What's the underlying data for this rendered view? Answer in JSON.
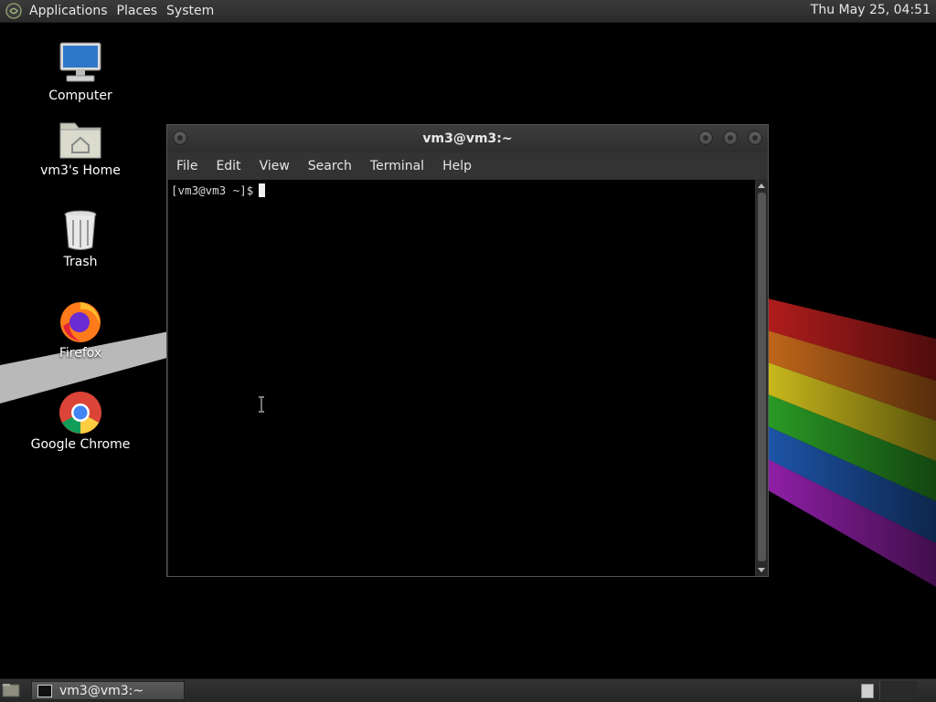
{
  "top_panel": {
    "menus": [
      "Applications",
      "Places",
      "System"
    ],
    "clock": "Thu May 25, 04:51"
  },
  "desktop": {
    "icons": [
      {
        "label": "Computer",
        "icon": "computer-icon"
      },
      {
        "label": "vm3's Home",
        "icon": "home-folder-icon"
      },
      {
        "label": "Trash",
        "icon": "trash-icon"
      },
      {
        "label": "Firefox",
        "icon": "firefox-icon"
      },
      {
        "label": "Google Chrome",
        "icon": "chrome-icon"
      }
    ]
  },
  "terminal": {
    "title": "vm3@vm3:~",
    "menu": [
      "File",
      "Edit",
      "View",
      "Search",
      "Terminal",
      "Help"
    ],
    "prompt": "[vm3@vm3 ~]$"
  },
  "taskbar": {
    "task_label": "vm3@vm3:~"
  }
}
